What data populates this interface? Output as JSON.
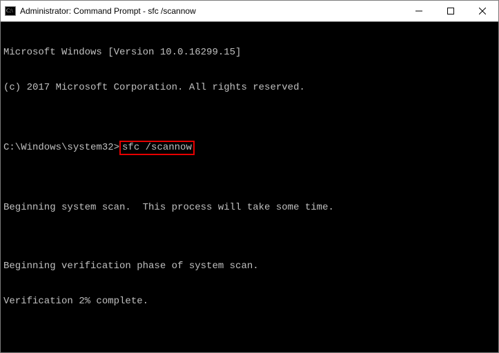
{
  "window": {
    "title": "Administrator: Command Prompt - sfc  /scannow"
  },
  "console": {
    "line1": "Microsoft Windows [Version 10.0.16299.15]",
    "line2": "(c) 2017 Microsoft Corporation. All rights reserved.",
    "blank1": "",
    "prompt_path": "C:\\Windows\\system32>",
    "command": "sfc /scannow",
    "blank2": "",
    "line3": "Beginning system scan.  This process will take some time.",
    "blank3": "",
    "line4": "Beginning verification phase of system scan.",
    "line5": "Verification 2% complete."
  }
}
